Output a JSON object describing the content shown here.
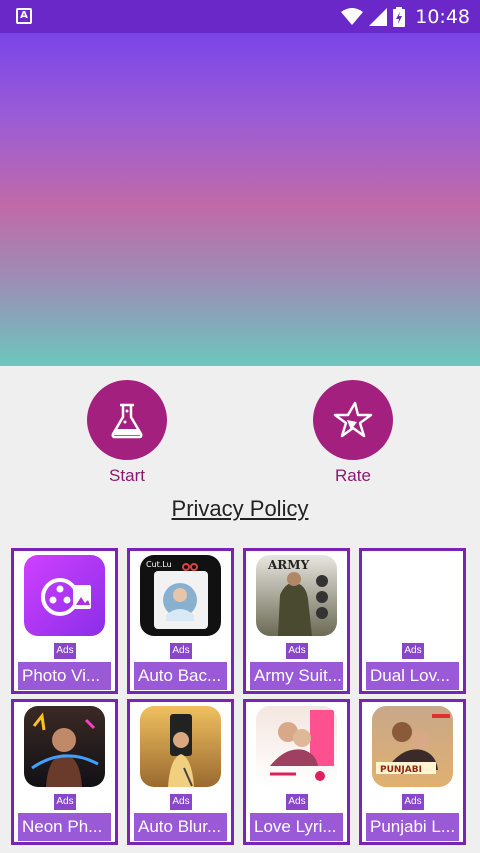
{
  "status_bar": {
    "time": "10:48",
    "notification": "A"
  },
  "actions": {
    "start_label": "Start",
    "rate_label": "Rate"
  },
  "privacy_label": "Privacy Policy",
  "ads": [
    {
      "name": "Photo Vi...",
      "badge": "Ads",
      "icon": "video-reel-icon"
    },
    {
      "name": "Auto Bac...",
      "badge": "Ads",
      "icon": "cut-paste-icon"
    },
    {
      "name": "Army Suit...",
      "badge": "Ads",
      "icon": "army-suit-icon"
    },
    {
      "name": "Dual Lov...",
      "badge": "Ads",
      "icon": "blank-icon"
    },
    {
      "name": "Neon Ph...",
      "badge": "Ads",
      "icon": "neon-photo-icon"
    },
    {
      "name": "Auto Blur...",
      "badge": "Ads",
      "icon": "blur-photo-icon"
    },
    {
      "name": "Love Lyri...",
      "badge": "Ads",
      "icon": "love-lyrics-icon"
    },
    {
      "name": "Punjabi L...",
      "badge": "Ads",
      "icon": "punjabi-lyrics-icon"
    }
  ],
  "thumb_text": {
    "cut": "Cut.Lu",
    "army": "ARMY",
    "punjabi": "PUNJABI"
  },
  "colors": {
    "status_bar": "#6a28c8",
    "accent": "#a3207f",
    "tile_border": "#7a24b4",
    "tile_label": "#9a5ad8"
  }
}
